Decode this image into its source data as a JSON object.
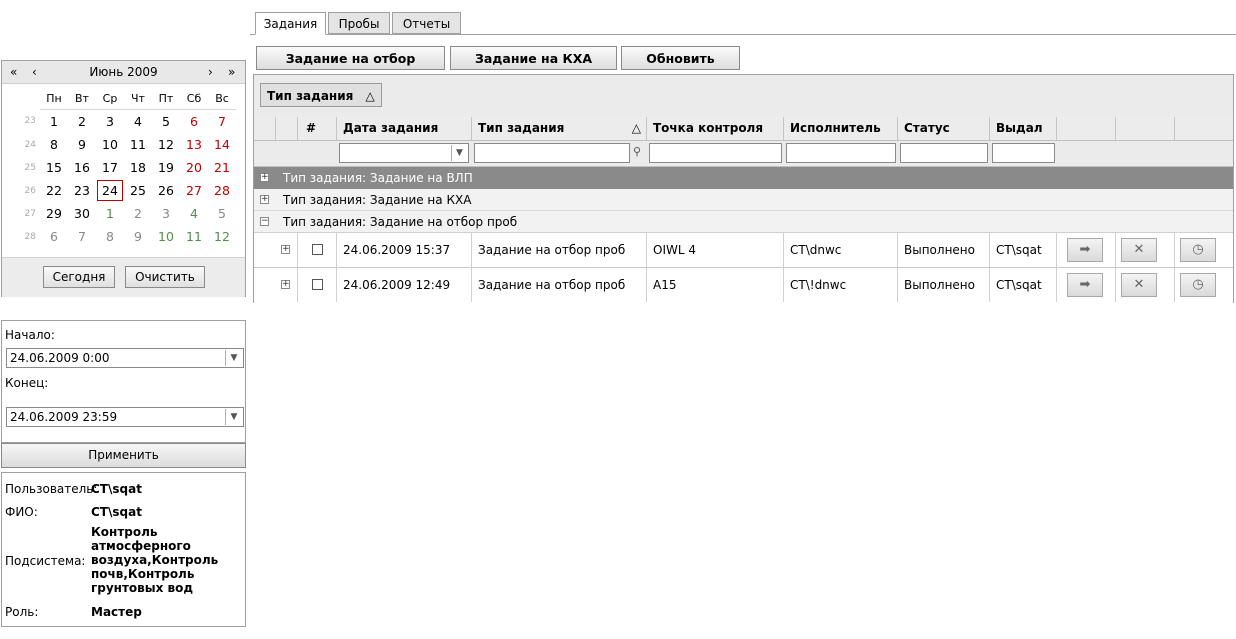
{
  "tabs": [
    {
      "label": "Задания",
      "active": true
    },
    {
      "label": "Пробы",
      "active": false
    },
    {
      "label": "Отчеты",
      "active": false
    }
  ],
  "toolbar": {
    "task_sampling": "Задание на отбор",
    "task_kxa": "Задание на КХА",
    "refresh": "Обновить"
  },
  "calendar": {
    "title": "Июнь 2009",
    "prev_year": "«",
    "prev_month": "‹",
    "next_month": "›",
    "next_year": "»",
    "weekdays": [
      "Пн",
      "Вт",
      "Ср",
      "Чт",
      "Пт",
      "Сб",
      "Вс"
    ],
    "weeks": [
      {
        "num": "23",
        "days": [
          "1",
          "2",
          "3",
          "4",
          "5",
          "6",
          "7"
        ]
      },
      {
        "num": "24",
        "days": [
          "8",
          "9",
          "10",
          "11",
          "12",
          "13",
          "14"
        ]
      },
      {
        "num": "25",
        "days": [
          "15",
          "16",
          "17",
          "18",
          "19",
          "20",
          "21"
        ]
      },
      {
        "num": "26",
        "days": [
          "22",
          "23",
          "24",
          "25",
          "26",
          "27",
          "28"
        ]
      },
      {
        "num": "27",
        "days": [
          "29",
          "30",
          "1",
          "2",
          "3",
          "4",
          "5"
        ]
      },
      {
        "num": "28",
        "days": [
          "6",
          "7",
          "8",
          "9",
          "10",
          "11",
          "12"
        ]
      }
    ],
    "selected_day": "24",
    "today_button": "Сегодня",
    "clear_button": "Очистить"
  },
  "range": {
    "start_label": "Начало:",
    "start_value": "24.06.2009 0:00",
    "end_label": "Конец:",
    "end_value": "24.06.2009 23:59",
    "apply": "Применить"
  },
  "user": {
    "user_label": "Пользователь:",
    "user_value": "CT\\sqat",
    "fio_label": "ФИО:",
    "fio_value": "CT\\sqat",
    "subsystem_label": "Подсистема:",
    "subsystem_lines": [
      "Контроль",
      "атмосферного",
      "воздуха,Контроль",
      "почв,Контроль",
      "грунтовых вод"
    ],
    "role_label": "Роль:",
    "role_value": "Мастер"
  },
  "grid": {
    "group_chip": "Тип задания",
    "columns": {
      "num": "#",
      "date": "Дата задания",
      "type": "Тип задания",
      "point": "Точка контроля",
      "executor": "Исполнитель",
      "status": "Статус",
      "issuer": "Выдал"
    },
    "groups": [
      "Тип задания: Задание на ВЛП",
      "Тип задания: Задание на КХА",
      "Тип задания: Задание на отбор проб"
    ],
    "rows": [
      {
        "date": "24.06.2009 15:37",
        "type": "Задание на отбор проб",
        "point": "OIWL 4",
        "executor": "CT\\dnwc",
        "status": "Выполнено",
        "issuer": "CT\\sqat"
      },
      {
        "date": "24.06.2009 12:49",
        "type": "Задание на отбор проб",
        "point": "A15",
        "executor": "CT\\!dnwc",
        "status": "Выполнено",
        "issuer": "CT\\sqat"
      }
    ]
  }
}
